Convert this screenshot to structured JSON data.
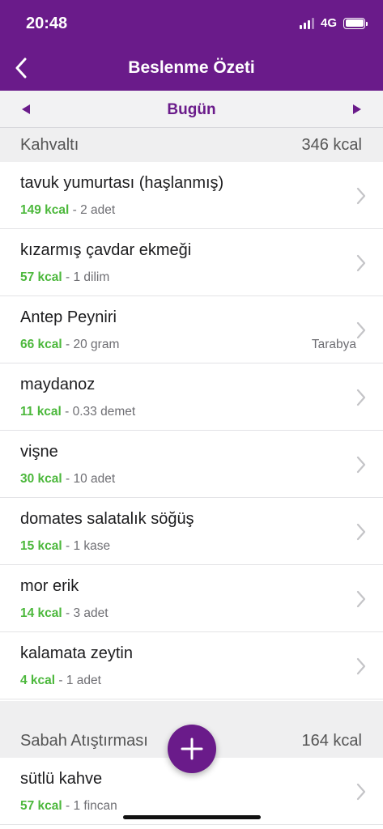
{
  "status_bar": {
    "time": "20:48",
    "network": "4G"
  },
  "nav": {
    "title": "Beslenme Özeti"
  },
  "date_bar": {
    "label": "Bugün"
  },
  "sections": [
    {
      "title": "Kahvaltı",
      "total": "346 kcal",
      "items": [
        {
          "name": "tavuk yumurtası (haşlanmış)",
          "kcal": "149 kcal",
          "amount": " - 2 adet",
          "brand": ""
        },
        {
          "name": "kızarmış çavdar ekmeği",
          "kcal": "57 kcal",
          "amount": " - 1 dilim",
          "brand": ""
        },
        {
          "name": "Antep Peyniri",
          "kcal": "66 kcal",
          "amount": " - 20 gram",
          "brand": "Tarabya"
        },
        {
          "name": "maydanoz",
          "kcal": "11 kcal",
          "amount": " - 0.33 demet",
          "brand": ""
        },
        {
          "name": "vişne",
          "kcal": "30 kcal",
          "amount": " - 10 adet",
          "brand": ""
        },
        {
          "name": "domates salatalık söğüş",
          "kcal": "15 kcal",
          "amount": " - 1 kase",
          "brand": ""
        },
        {
          "name": "mor erik",
          "kcal": "14 kcal",
          "amount": " - 3 adet",
          "brand": ""
        },
        {
          "name": "kalamata zeytin",
          "kcal": "4 kcal",
          "amount": " - 1 adet",
          "brand": ""
        }
      ]
    },
    {
      "title": "Sabah Atıştırması",
      "total": "164 kcal",
      "items": [
        {
          "name": "sütlü kahve",
          "kcal": "57 kcal",
          "amount": " - 1 fincan",
          "brand": ""
        }
      ]
    }
  ],
  "icons": {
    "back": "chevron-left-icon",
    "prev": "triangle-left-icon",
    "next": "triangle-right-icon",
    "row": "chevron-right-icon",
    "add": "plus-icon"
  },
  "colors": {
    "brand": "#6a1b8a",
    "kcal": "#4cb83c",
    "section_bg": "#efeff0"
  }
}
